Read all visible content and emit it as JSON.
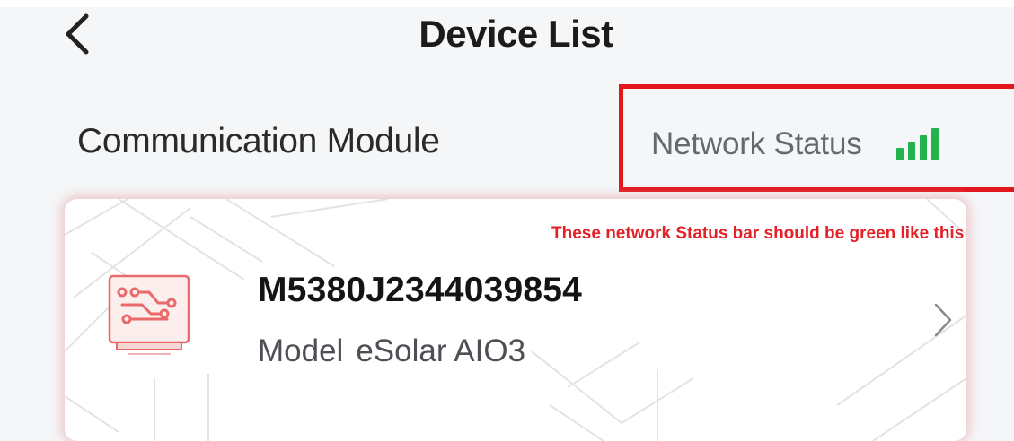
{
  "header": {
    "title": "Device List",
    "back_icon": "chevron-left-icon"
  },
  "section": {
    "label": "Communication Module"
  },
  "network_status": {
    "label": "Network Status",
    "signal_icon": "signal-bars-icon",
    "signal_level": 4,
    "signal_max": 4,
    "signal_color": "#23b34c"
  },
  "annotation": {
    "text": "These network Status bar should be green like this",
    "color": "#e32127",
    "box_color": "#e0171d"
  },
  "device": {
    "id": "M5380J2344039854",
    "model_label": "Model",
    "model_value": "eSolar AIO3",
    "icon": "circuit-module-icon",
    "accent_color": "#e86a6a",
    "chevron_icon": "chevron-right-icon"
  }
}
